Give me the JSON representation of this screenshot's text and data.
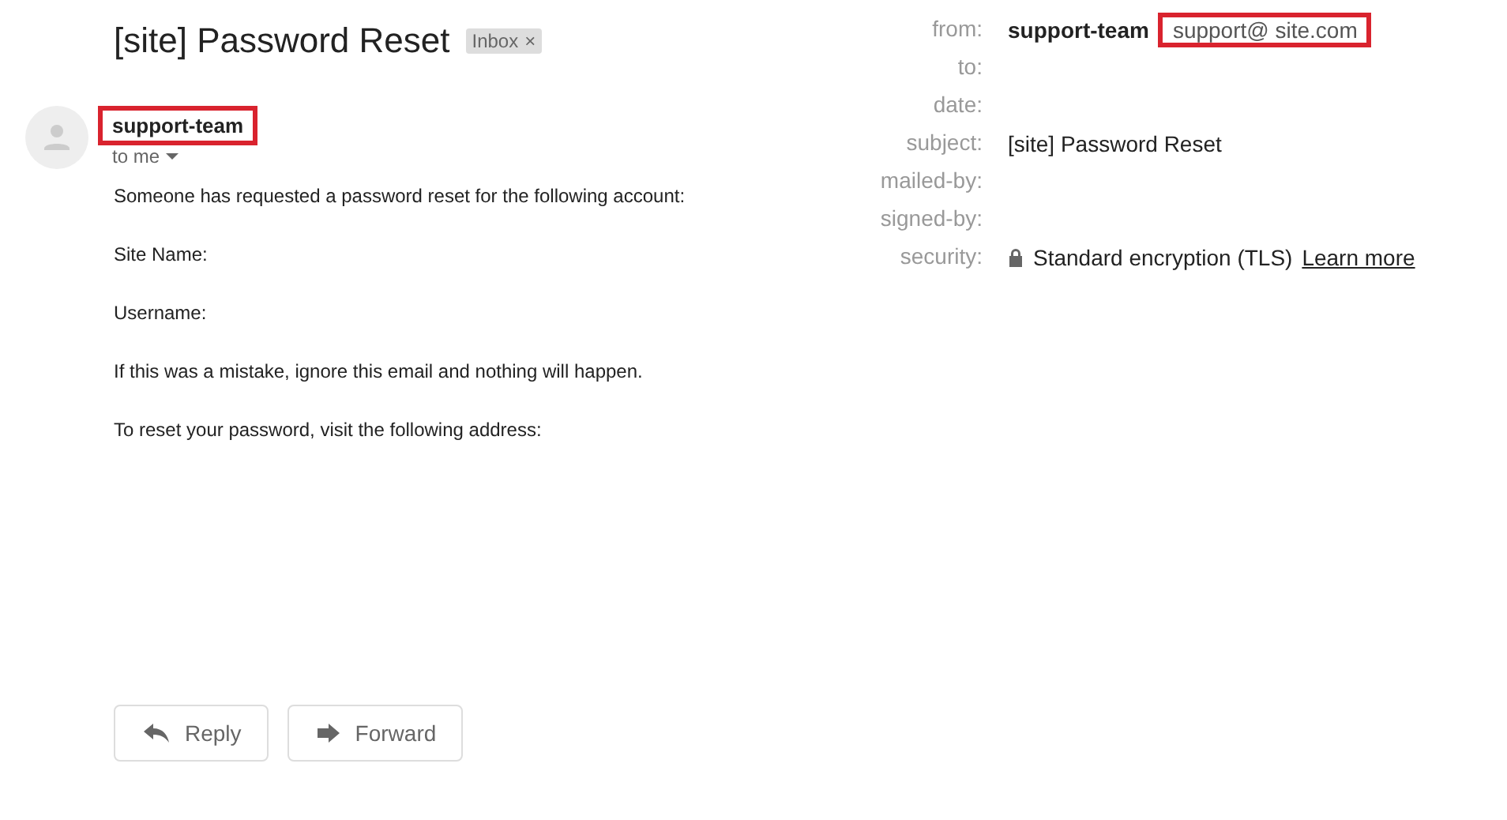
{
  "subject": "[site] Password Reset",
  "label": {
    "text": "Inbox",
    "close": "×"
  },
  "sender": {
    "name": "support-team",
    "highlighted": true,
    "recipient": "to me"
  },
  "body": [
    "Someone has requested a password reset for the following account:",
    "Site Name:",
    "Username:",
    "If this was a mistake, ignore this email and nothing will happen.",
    "To reset your password, visit the following address:"
  ],
  "details": [
    {
      "label": "from:",
      "kind": "sender",
      "name": "support-team",
      "address": "support@ site.com",
      "highlighted": true
    },
    {
      "label": "to:",
      "kind": "empty"
    },
    {
      "label": "date:",
      "kind": "empty"
    },
    {
      "label": "subject:",
      "kind": "text",
      "value": "[site] Password Reset"
    },
    {
      "label": "mailed-by:",
      "kind": "empty"
    },
    {
      "label": "signed-by:",
      "kind": "empty"
    },
    {
      "label": "security:",
      "kind": "security",
      "value": "Standard encryption (TLS)",
      "link": "Learn more"
    }
  ],
  "actions": [
    {
      "label": "Reply",
      "kind": "reply"
    },
    {
      "label": "Forward",
      "kind": "forward"
    }
  ]
}
